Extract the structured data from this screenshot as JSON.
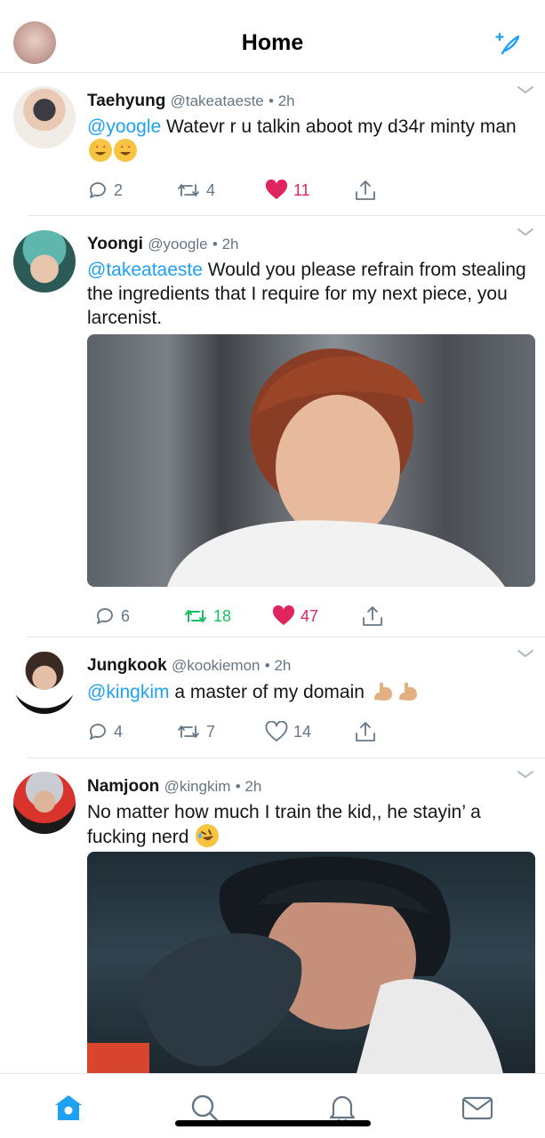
{
  "header": {
    "title": "Home"
  },
  "tweets": [
    {
      "name": "Taehyung",
      "handle": "@takeataeste",
      "time": "• 2h",
      "mention": "@yoogle",
      "text": " Watevr r u talkin aboot my d34r minty man",
      "emoji": [
        "star-struck-icon",
        "star-struck-icon"
      ],
      "replies": "2",
      "retweets": "4",
      "likes": "11",
      "liked": true,
      "retweeted": false
    },
    {
      "name": "Yoongi",
      "handle": "@yoogle",
      "time": "• 2h",
      "mention": "@takeataeste",
      "text": " Would you please refrain from stealing the ingredients that I require for my next piece, you larcenist.",
      "has_media": true,
      "replies": "6",
      "retweets": "18",
      "likes": "47",
      "liked": true,
      "retweeted": true
    },
    {
      "name": "Jungkook",
      "handle": "@kookiemon",
      "time": "• 2h",
      "mention": "@kingkim",
      "text": " a master of my domain",
      "emoji": [
        "flexed-biceps-icon",
        "flexed-biceps-icon"
      ],
      "replies": "4",
      "retweets": "7",
      "likes": "14",
      "liked": false,
      "retweeted": false
    },
    {
      "name": "Namjoon",
      "handle": "@kingkim",
      "time": "• 2h",
      "text": "No matter how much I train the kid,, he stayin’ a fucking nerd",
      "emoji": [
        "rolling-on-floor-laughing-icon"
      ],
      "has_media": true
    }
  ],
  "tabbar": {
    "items": [
      "home-icon",
      "search-icon",
      "notifications-icon",
      "messages-icon"
    ],
    "active": "home-icon"
  },
  "colors": {
    "accent": "#1da1f2",
    "like": "#e0245e",
    "retweet": "#17bf63",
    "secondary_text": "#657786"
  }
}
